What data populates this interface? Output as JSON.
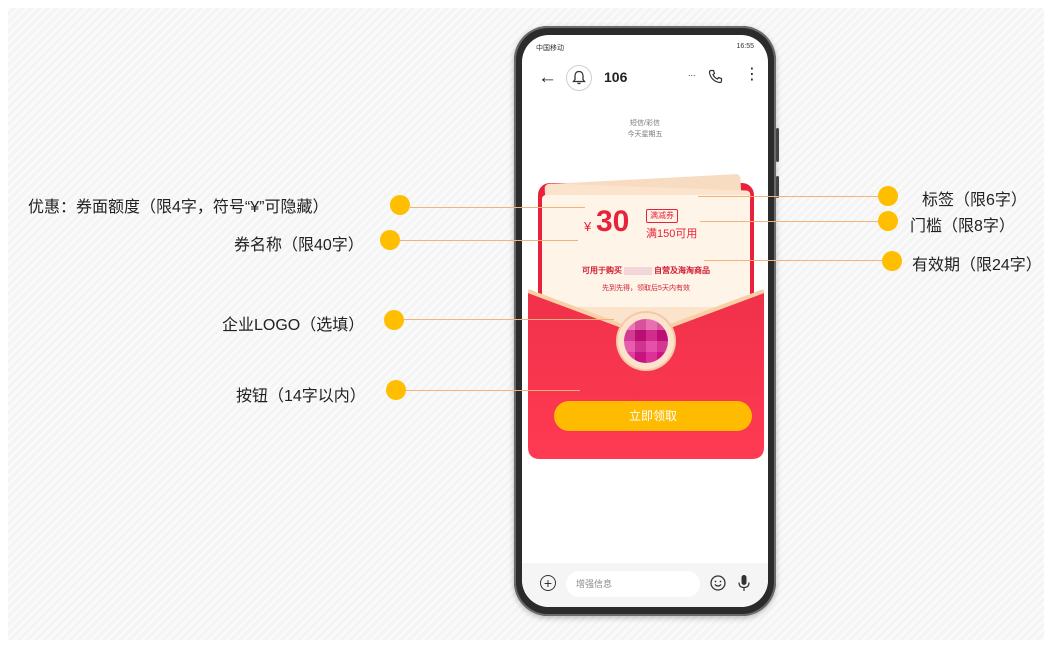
{
  "phone": {
    "status": {
      "carrier": "中国移动",
      "time": "16:55"
    },
    "header": {
      "contact_number": "106",
      "more_dots": "..."
    },
    "date_header": {
      "line1": "短信/彩信",
      "line2": "今天星期五"
    },
    "coupon": {
      "currency_symbol": "¥",
      "amount": "30",
      "tag": "满减券",
      "threshold": "满150可用",
      "name_prefix": "可用于购买",
      "name_suffix": "自营及海淘商品",
      "validity": "先到先得，领取后5天内有效",
      "button_label": "立即领取"
    },
    "input": {
      "placeholder": "增强信息"
    }
  },
  "annotations": {
    "discount": "优惠：券面额度（限4字，符号“¥”可隐藏）",
    "coupon_name": "券名称（限40字）",
    "logo": "企业LOGO（选填）",
    "button": "按钮（14字以内）",
    "tag": "标签（限6字）",
    "threshold": "门槛（限8字）",
    "validity": "有效期（限24字）"
  },
  "colors": {
    "accent_red": "#e8223a",
    "button_yellow": "#ffbb00",
    "annotation_dot": "#ffbe00"
  }
}
